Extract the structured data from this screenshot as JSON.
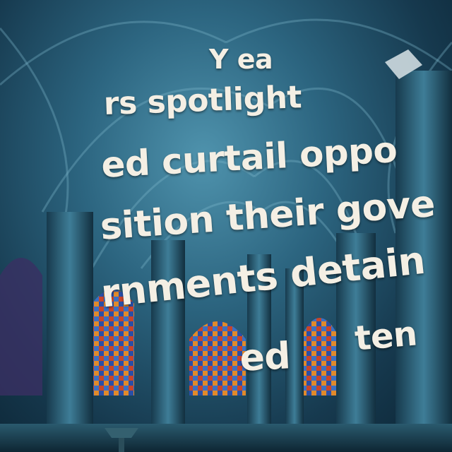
{
  "scene": {
    "description_icon": "gothic-cathedral-interior",
    "colors": {
      "stone": "#2c6580",
      "deep_shadow": "#0a2130",
      "glass_red": "#c8452a",
      "glass_blue": "#2a4fa8",
      "glass_orange": "#e08a2c",
      "text": "#f4efe4"
    }
  },
  "caption": {
    "line1": "Y ea",
    "line2": "rs spotlight",
    "line3": "ed curtail oppo",
    "line4": "sition their gove",
    "line5": "rnments detain",
    "line6a": "ed",
    "line6b": "ten"
  }
}
